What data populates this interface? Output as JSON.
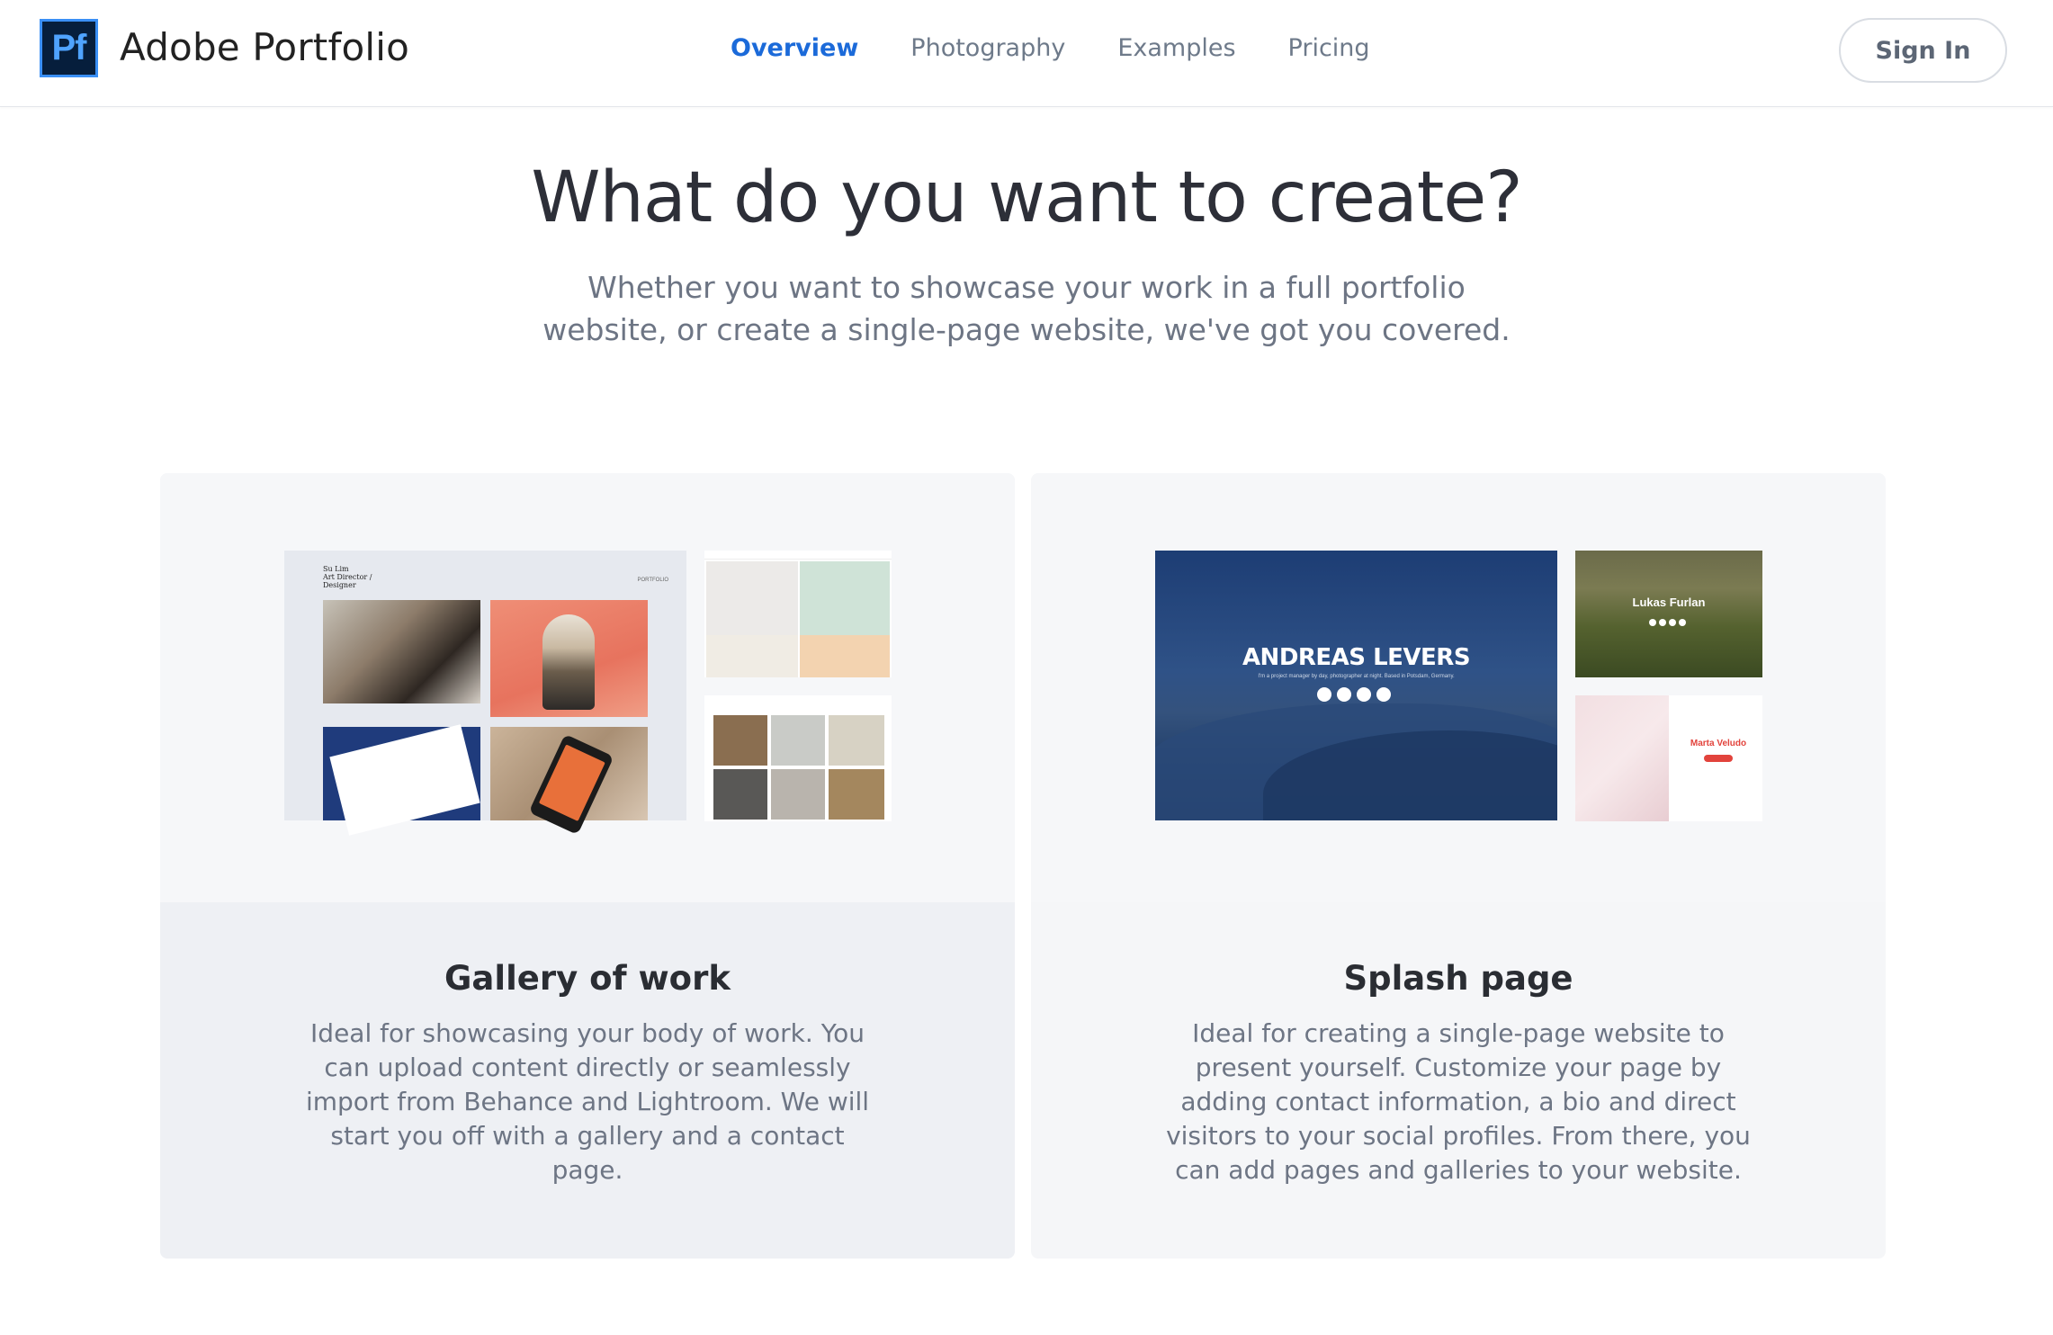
{
  "header": {
    "logo_text": "Pf",
    "brand": "Adobe Portfolio",
    "nav": [
      {
        "label": "Overview",
        "active": true
      },
      {
        "label": "Photography",
        "active": false
      },
      {
        "label": "Examples",
        "active": false
      },
      {
        "label": "Pricing",
        "active": false
      }
    ],
    "signin_label": "Sign In"
  },
  "hero": {
    "title": "What do you want to create?",
    "subtitle": "Whether you want to showcase your work in a full portfolio website, or create a single-page website, we've got you covered."
  },
  "cards": [
    {
      "title": "Gallery of work",
      "description": "Ideal for showcasing your body of work. You can upload content directly or seamlessly import from Behance and Lightroom. We will start you off with a gallery and a contact page.",
      "preview_title": "Su Lim\nArt Director /\nDesigner",
      "preview_label": "PORTFOLIO"
    },
    {
      "title": "Splash page",
      "description": "Ideal for creating a single-page website to present yourself. Customize your page by adding contact information, a bio and direct visitors to your social profiles. From there, you can add pages and galleries to your website.",
      "preview_names": [
        "ANDREAS LEVERS",
        "Lukas Furlan",
        "Marta Veludo"
      ],
      "preview_tagline": "I'm a project manager by day, photographer at night. Based in Potsdam, Germany."
    }
  ],
  "colors": {
    "accent": "#1b6ad9",
    "logo_bg": "#061e3c",
    "logo_fg": "#4fa3ff",
    "muted_text": "#6d7584"
  }
}
